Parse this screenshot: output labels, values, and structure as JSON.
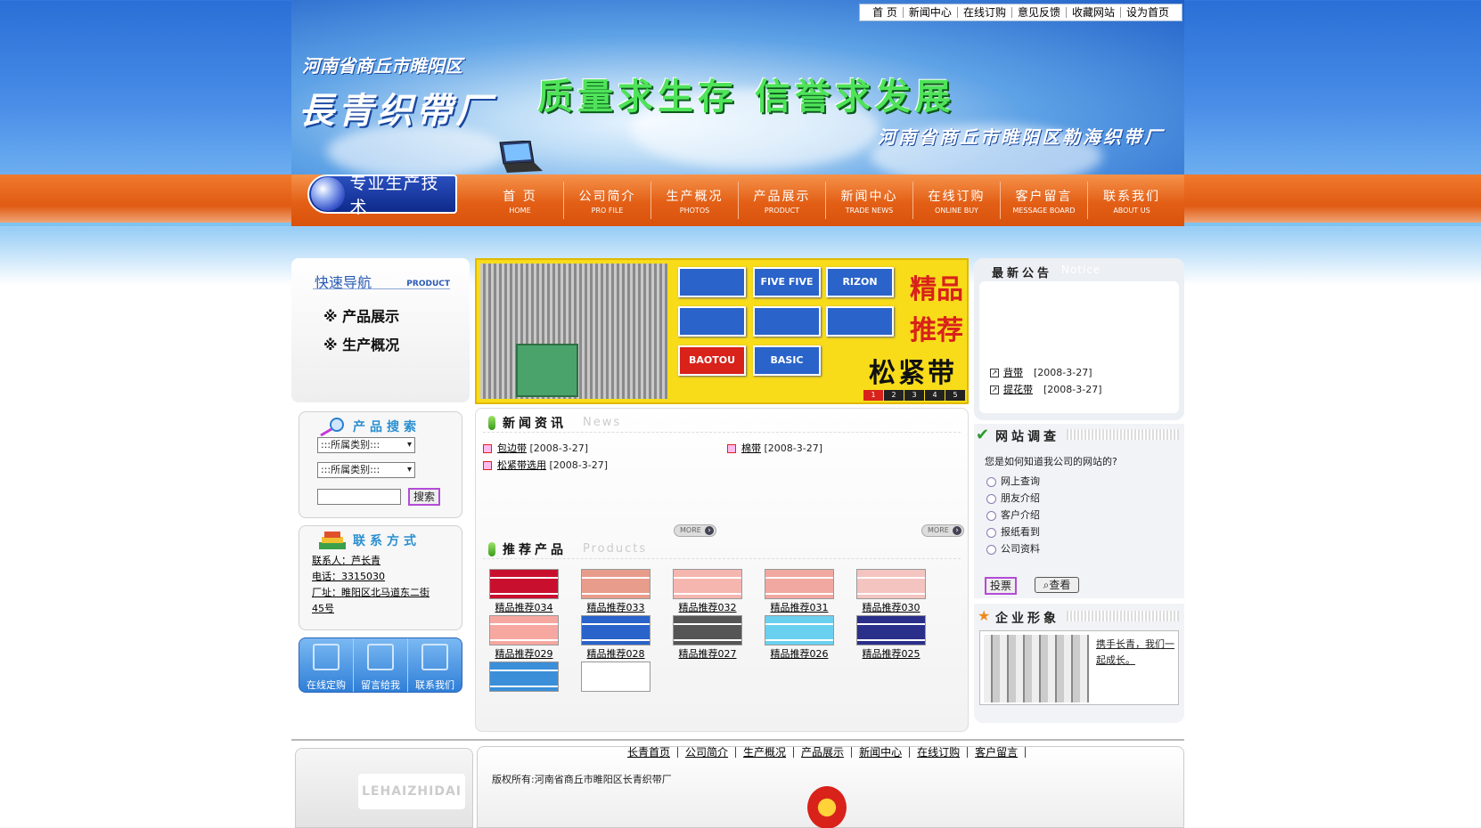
{
  "header": {
    "top_links": [
      "首 页",
      "新闻中心",
      "在线订购",
      "意见反馈",
      "收藏网站",
      "设为首页"
    ],
    "region_title": "河南省商丘市睢阳区",
    "factory_name": "長青织帶厂",
    "slogan": "质量求生存  信誉求发展",
    "sub_slogan": "河南省商丘市睢阳区勒海织带厂",
    "tech_badge": "专业生产技术"
  },
  "menu": [
    {
      "cn": "首  页",
      "en": "HOME"
    },
    {
      "cn": "公司简介",
      "en": "PRO FILE"
    },
    {
      "cn": "生产概况",
      "en": "PHOTOS"
    },
    {
      "cn": "产品展示",
      "en": "PRODUCT"
    },
    {
      "cn": "新闻中心",
      "en": "TRADE NEWS"
    },
    {
      "cn": "在线订购",
      "en": "ONLINE BUY"
    },
    {
      "cn": "客户留言",
      "en": "MESSAGE BOARD"
    },
    {
      "cn": "联系我们",
      "en": "ABOUT US"
    }
  ],
  "quicknav": {
    "title": "快速导航",
    "en": "PRODUCT",
    "items": [
      "※ 产品展示",
      "※ 生产概况"
    ]
  },
  "product_search": {
    "title": "产品搜索",
    "select1": ":::所属类别:::",
    "select2": ":::所属类别:::",
    "button": "搜索"
  },
  "contact": {
    "title": "联系方式",
    "lines": [
      "联系人：芦长青",
      "电话：3315030",
      "厂址：睢阳区北马道东二街",
      "45号"
    ]
  },
  "quick_buttons": [
    "在线定购",
    "留言给我",
    "联系我们"
  ],
  "banner": {
    "swatches": [
      "",
      "FIVE FIVE",
      "RIZON HORIZ",
      "",
      "",
      "",
      "BAOTOU",
      "BASIC"
    ],
    "text_red": [
      "精品",
      "推荐"
    ],
    "text_black": "松紧带",
    "pages": [
      "1",
      "2",
      "3",
      "4",
      "5"
    ]
  },
  "news": {
    "title": "新闻资讯",
    "en": "News",
    "items": [
      {
        "title": "包边带",
        "date": "[2008-3-27]"
      },
      {
        "title": "松紧带选用",
        "date": "[2008-3-27]"
      },
      {
        "title": "棉带",
        "date": "[2008-3-27]"
      }
    ],
    "more": "MORE"
  },
  "products": {
    "title": "推荐产品",
    "en": "Products",
    "more": "MORE",
    "items": [
      {
        "label": "精品推荐034",
        "color": "#c8102e"
      },
      {
        "label": "精品推荐033",
        "color": "#e89c8c"
      },
      {
        "label": "精品推荐032",
        "color": "#f6b6b0"
      },
      {
        "label": "精品推荐031",
        "color": "#f0a8a0"
      },
      {
        "label": "精品推荐030",
        "color": "#f4c4c0"
      },
      {
        "label": "精品推荐029",
        "color": "#f6a8a0"
      },
      {
        "label": "精品推荐028",
        "color": "#2a63c9"
      },
      {
        "label": "精品推荐027",
        "color": "#555"
      },
      {
        "label": "精品推荐026",
        "color": "#6ad0f0"
      },
      {
        "label": "精品推荐025",
        "color": "#2a2f8a"
      },
      {
        "label": "",
        "color": "#3a8fd8"
      },
      {
        "label": "",
        "color": "#fff"
      }
    ]
  },
  "notice": {
    "title": "最新公告",
    "en": "Notice",
    "items": [
      {
        "title": "背带",
        "date": "[2008-3-27]"
      },
      {
        "title": "提花带",
        "date": "[2008-3-27]"
      }
    ]
  },
  "survey": {
    "title": "网站调查",
    "question": "您是如何知道我公司的网站的?",
    "options": [
      "网上查询",
      "朋友介绍",
      "客户介绍",
      "报纸看到",
      "公司资料"
    ],
    "vote": "投票",
    "view": "查看"
  },
  "company_image": {
    "title": "企业形象",
    "caption": "携手长青，我们一起成长。"
  },
  "footer": {
    "links": [
      "长青首页",
      "公司简介",
      "生产概况",
      "产品展示",
      "新闻中心",
      "在线订购",
      "客户留言"
    ],
    "copyright": "版权所有:河南省商丘市睢阳区长青织带厂",
    "logo": "LEHAIZHIDAI"
  }
}
